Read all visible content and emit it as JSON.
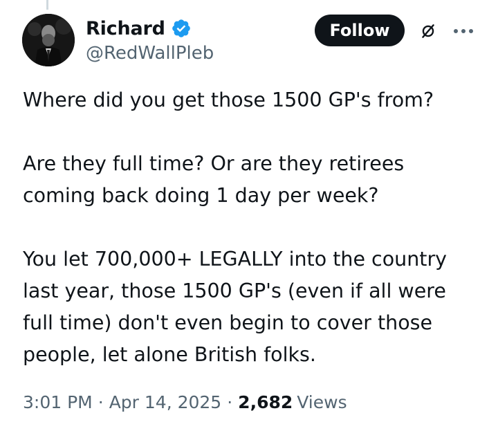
{
  "author": {
    "display_name": "Richard",
    "handle": "@RedWallPleb",
    "verified_icon": "verified-badge-icon",
    "avatar_icon": "profile-avatar"
  },
  "actions": {
    "follow_label": "Follow",
    "grok_icon": "grok-icon",
    "more_icon": "more-options-icon"
  },
  "tweet": {
    "paragraphs": [
      "Where did you get those 1500 GP's from?",
      "Are they full time? Or are they retirees coming back doing 1 day per week?",
      "You let 700,000+ LEGALLY into the country last year, those 1500 GP's (even if all were full time) don't even begin to cover those people, let alone British folks."
    ]
  },
  "meta": {
    "time": "3:01 PM",
    "separator": "·",
    "date": "Apr 14, 2025",
    "views_count": "2,682",
    "views_label": "Views"
  },
  "colors": {
    "text_primary": "#0f1419",
    "text_secondary": "#536471",
    "verified_blue": "#1d9bf0",
    "follow_bg": "#0f1419"
  }
}
